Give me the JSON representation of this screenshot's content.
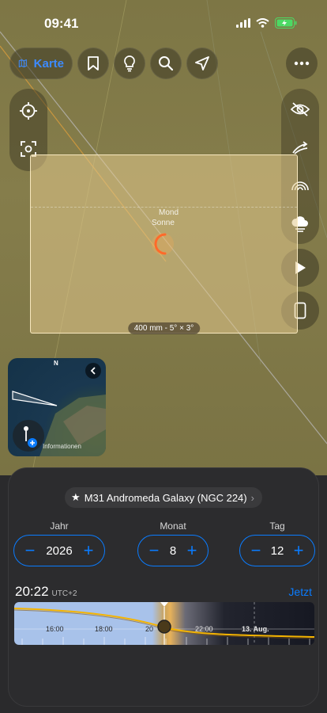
{
  "status": {
    "time": "09:41"
  },
  "toolbar": {
    "map_label": "Karte"
  },
  "frame": {
    "label": "400 mm - 5° × 3°",
    "moon_label": "Mond",
    "sun_label": "Sonne"
  },
  "minimap": {
    "north": "N",
    "info_label": "Informationen"
  },
  "sheet": {
    "object": {
      "star": "★",
      "name": "M31 Andromeda Galaxy (NGC 224)",
      "chevron": "›"
    },
    "year": {
      "label": "Jahr",
      "value": "2026"
    },
    "month": {
      "label": "Monat",
      "value": "8"
    },
    "day": {
      "label": "Tag",
      "value": "12"
    },
    "minus": "−",
    "plus": "+",
    "time": "20:22",
    "timezone": "UTC+2",
    "now_label": "Jetzt",
    "ticks": [
      "16:00",
      "18:00",
      "20",
      "22:00",
      "13. Aug."
    ]
  },
  "colors": {
    "accent": "#0a7cff",
    "path": "#f5b400"
  }
}
